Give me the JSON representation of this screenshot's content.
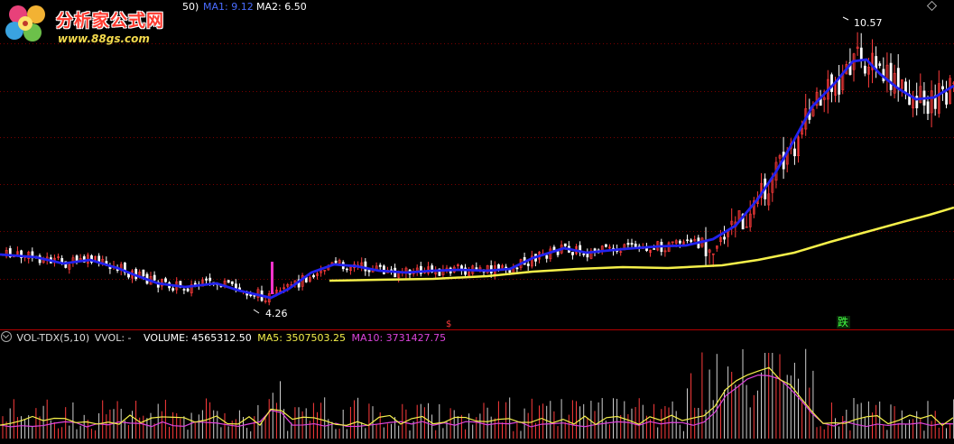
{
  "colors": {
    "background": "#000000",
    "grid": "#7a0000",
    "divider": "#b00000",
    "up": "#ff3b3b",
    "down": "#ffffff",
    "ma1": "#2222ee",
    "ma2": "#f5f04a",
    "ma5_vol": "#f5f04a",
    "ma10_vol": "#dd44dd",
    "label": "#ffffff",
    "header_ma1": "#4a6cff",
    "header_ma2": "#ffffff"
  },
  "header": {
    "value_fragment": "50)",
    "ma1_label": "MA1: 9.12",
    "ma2_label": "MA2: 6.50"
  },
  "logo": {
    "text": "分析家公式网",
    "url": "www.88gs.com"
  },
  "main_chart": {
    "price_range": [
      3.6,
      11.4
    ],
    "high_label": "10.57",
    "low_label": "4.26",
    "signal_marker": "跌",
    "small_marker": "$"
  },
  "volume_panel": {
    "indicator_name": "VOL-TDX(5,10)",
    "vvol_label": "VVOL: -",
    "volume_label": "VOLUME: 4565312.50",
    "ma5_label": "MA5: 3507503.25",
    "ma10_label": "MA10: 3731427.75"
  },
  "icons": {
    "collapse": "circle-chevron-down-icon",
    "top_right": "diamond-icon",
    "logo": "flower-logo-icon"
  }
}
